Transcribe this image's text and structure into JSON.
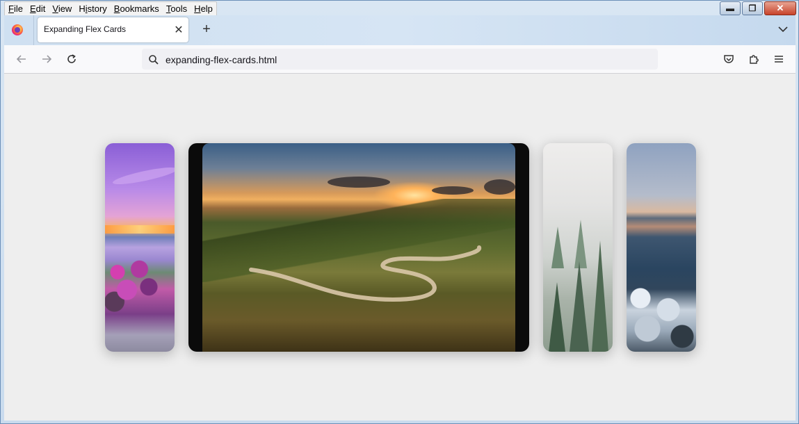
{
  "menu": [
    {
      "key": "F",
      "rest": "ile"
    },
    {
      "key": "E",
      "rest": "dit"
    },
    {
      "key": "V",
      "rest": "iew"
    },
    {
      "key": "H",
      "rest": "istory",
      "pre": ""
    },
    {
      "key": "B",
      "rest": "ookmarks"
    },
    {
      "key": "T",
      "rest": "ools"
    },
    {
      "key": "H",
      "rest": "elp"
    }
  ],
  "tab": {
    "title": "Expanding Flex Cards",
    "close_glyph": "✕"
  },
  "new_tab_glyph": "+",
  "urlbar": {
    "url": "expanding-flex-cards.html"
  },
  "window_controls": {
    "minimize": "▬",
    "maximize": "❐",
    "close": "✕"
  },
  "cards": [
    {
      "name": "lake-flowers",
      "active": false
    },
    {
      "name": "winding-road-valley",
      "active": true
    },
    {
      "name": "misty-forest",
      "active": false
    },
    {
      "name": "rocky-coast",
      "active": false
    }
  ],
  "colors": {
    "content_bg": "#eeeeee",
    "accent": "#0060df"
  }
}
